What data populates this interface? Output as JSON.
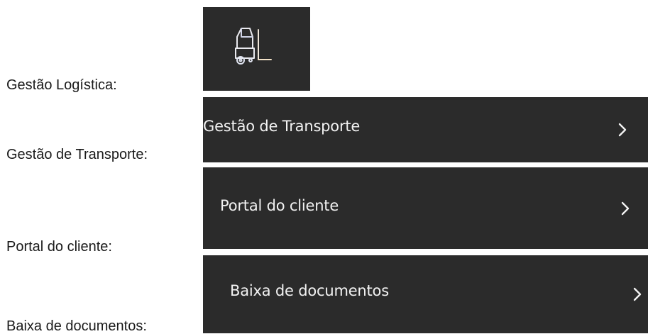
{
  "labels": {
    "logistica": "Gestão Logística:",
    "transporte": "Gestão de Transporte:",
    "portal": "Portal do cliente:",
    "baixa": "Baixa de documentos:"
  },
  "logistics_tile": {
    "icon": "forklift-icon",
    "background": "#2b2b2b"
  },
  "menu": {
    "background": "#2b2b2b",
    "text_color": "#f2f2f2",
    "items": [
      {
        "label": "Gestão de Transporte",
        "icon": "chevron-right-icon"
      },
      {
        "label": "Portal do cliente",
        "icon": "chevron-right-icon"
      },
      {
        "label": "Baixa de documentos",
        "icon": "chevron-right-icon"
      }
    ]
  }
}
